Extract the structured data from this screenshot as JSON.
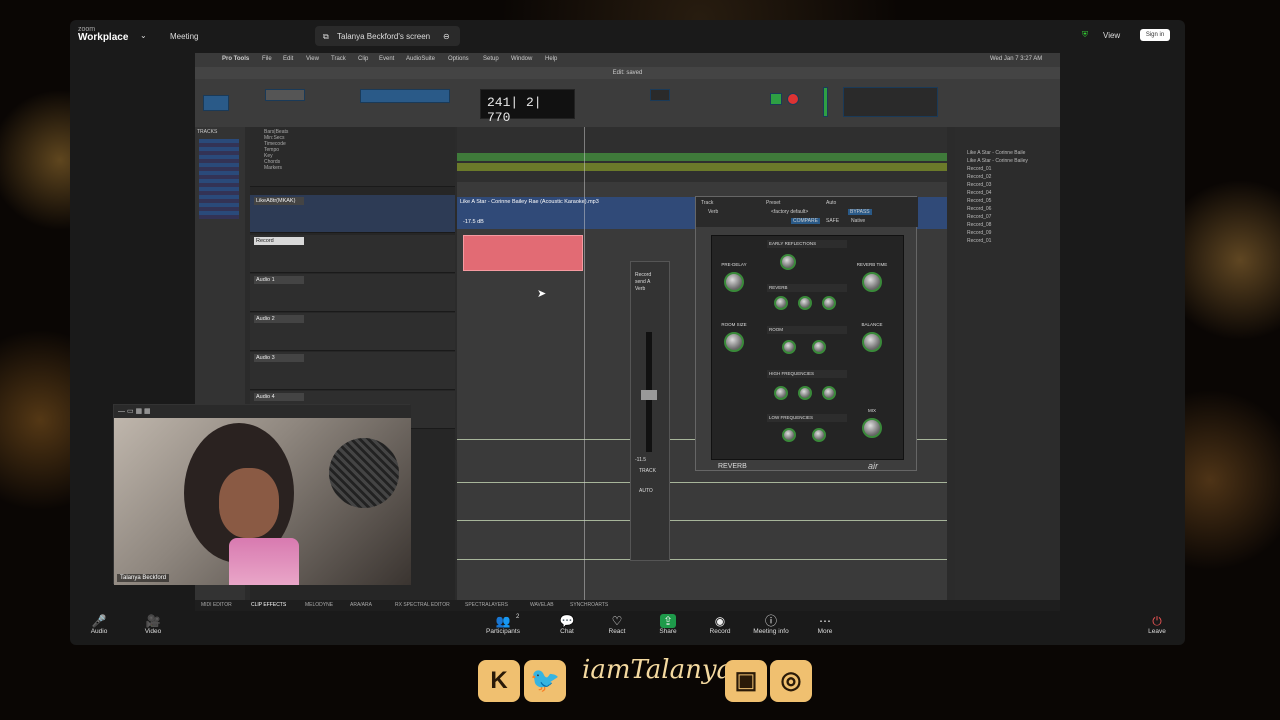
{
  "zoom": {
    "brand": "zoom",
    "product": "Workplace",
    "meeting_label": "Meeting",
    "share_label": "Talanya Beckford's screen",
    "view_label": "View",
    "signin_label": "Sign in",
    "toolbar": [
      {
        "label": "Audio",
        "icon": "🎤"
      },
      {
        "label": "Video",
        "icon": "🎥"
      },
      {
        "label": "Participants",
        "icon": "👥"
      },
      {
        "label": "Chat",
        "icon": "💬"
      },
      {
        "label": "React",
        "icon": "♡"
      },
      {
        "label": "Share",
        "icon": "⇪"
      },
      {
        "label": "Record",
        "icon": "◉"
      },
      {
        "label": "Meeting info",
        "icon": "ⓘ"
      },
      {
        "label": "More",
        "icon": "⋯"
      },
      {
        "label": "Leave",
        "icon": "⏻"
      }
    ],
    "participants_count": "2"
  },
  "protools": {
    "menu": [
      "Pro Tools",
      "File",
      "Edit",
      "View",
      "Track",
      "Clip",
      "Event",
      "AudioSuite",
      "Options",
      "Setup",
      "Window",
      "Help"
    ],
    "clock": "Wed Jan 7  3:27 AM",
    "edit_title": "Edit: saved",
    "counter": "241| 2| 770",
    "tracks_header": "TRACKS",
    "tracks": [
      "LikeA8tr(MKAK)",
      "Record",
      "Audio 1",
      "Audio 2",
      "Audio 3",
      "Audio 4"
    ],
    "clip_title": "Like A Star - Corinne Bailey Rae (Acoustic Karaoke).mp3",
    "clip_gain": "-17.5 dB",
    "rulers": [
      "Bars|Beats",
      "Min:Secs",
      "Timecode",
      "Tempo",
      "Key",
      "Chords",
      "Markers"
    ],
    "send": {
      "name": "Record",
      "send": "send A",
      "mode": "Verb",
      "value": "-11.5",
      "track": "TRACK",
      "auto": "AUTO"
    },
    "right_list": [
      "Like A Star - Corinne Baile",
      "Like A Star - Corinne Bailey",
      "Record_01",
      "Record_02",
      "Record_03",
      "Record_04",
      "Record_05",
      "Record_06",
      "Record_07",
      "Record_08",
      "Record_09",
      "Record_01"
    ],
    "dock": [
      "MIDI EDITOR",
      "CLIP EFFECTS",
      "MELODYNE",
      "ARA/ARA",
      "RX SPECTRAL EDITOR",
      "SPECTRALAYERS",
      "WAVELAB",
      "SYNCHROARTS"
    ]
  },
  "plugin": {
    "track_label": "Track",
    "preset_label": "Preset",
    "auto_label": "Auto",
    "track_value": "Verb",
    "preset_value": "<factory default>",
    "compare": "COMPARE",
    "safe": "SAFE",
    "bypass": "BYPASS",
    "native": "Native",
    "name": "REVERB",
    "logo": "air",
    "sections": [
      "EARLY REFLECTIONS",
      "REVERB",
      "ROOM",
      "HIGH FREQUENCIES",
      "LOW FREQUENCIES"
    ],
    "knobs": [
      {
        "label": "PRE-DELAY"
      },
      {
        "label": "ROOM SIZE"
      },
      {
        "label": "REVERB TIME"
      },
      {
        "label": "BALANCE"
      },
      {
        "label": "MIX"
      }
    ]
  },
  "webcam": {
    "name": "Talanya Beckford"
  },
  "footer": {
    "handle": "iamTalanya"
  }
}
